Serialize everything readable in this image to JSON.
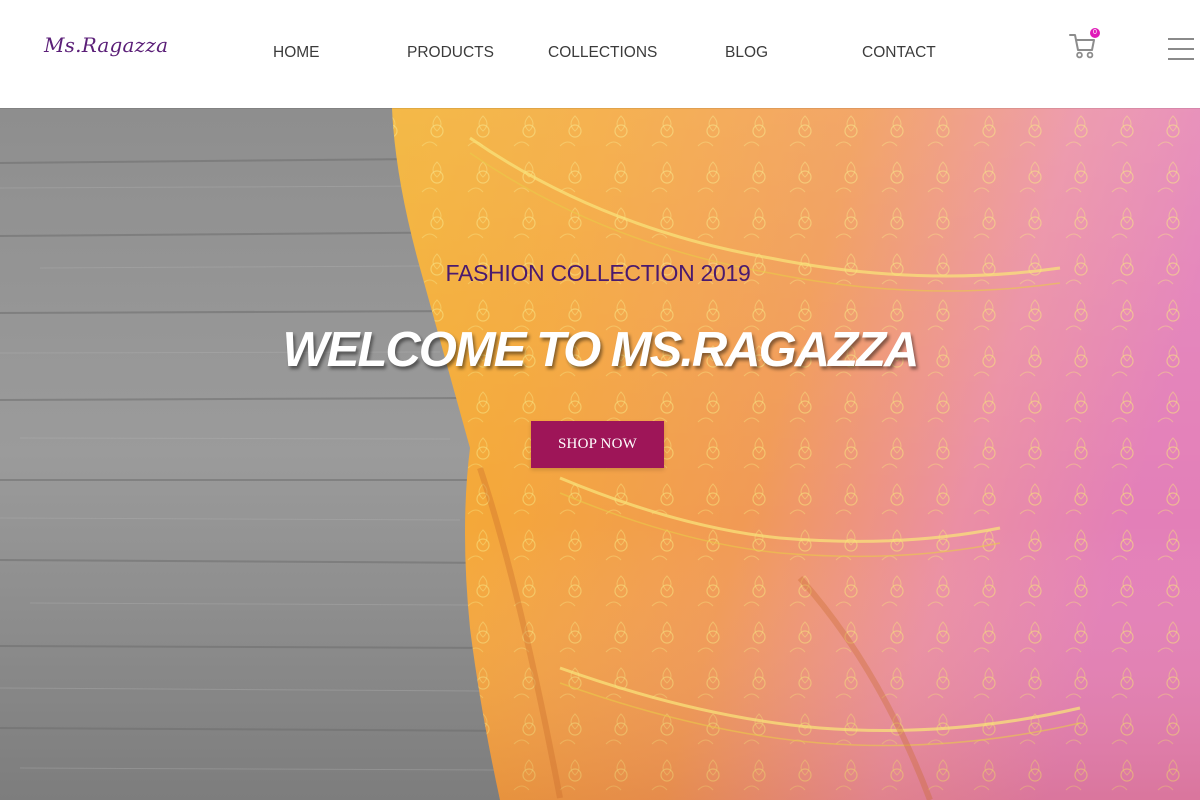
{
  "header": {
    "logo_text": "Ms.Ragazza",
    "nav": [
      {
        "label": "HOME"
      },
      {
        "label": "PRODUCTS"
      },
      {
        "label": "COLLECTIONS"
      },
      {
        "label": "BLOG"
      },
      {
        "label": "CONTACT"
      }
    ],
    "cart_icon": "shopping-cart-icon",
    "cart_count": "0",
    "menu_icon": "hamburger-menu-icon"
  },
  "hero": {
    "subtitle": "FASHION COLLECTION 2019",
    "title": "WELCOME TO MS.RAGAZZA",
    "cta_label": "SHOP NOW"
  },
  "colors": {
    "brand_purple": "#5b1f78",
    "subtitle_purple": "#4a1a6e",
    "cta_background": "#9e1558",
    "cart_badge": "#e01ab8"
  }
}
